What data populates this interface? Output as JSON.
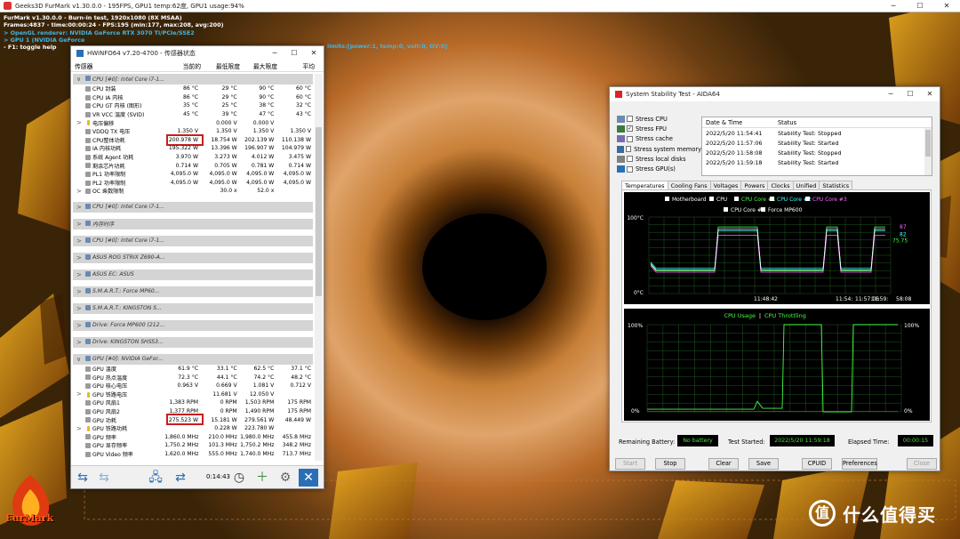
{
  "furmark": {
    "title": "Geeks3D FurMark v1.30.0.0 - 195FPS, GPU1 temp:62度, GPU1 usage:94%",
    "osd": [
      {
        "text": "FurMark v1.30.0.0 - Burn-in test, 1920x1080 (8X MSAA)",
        "color": "w"
      },
      {
        "text": "Frames:4837 - time:00:00:24 - FPS:195 (min:177, max:208, avg:200)",
        "color": "w"
      },
      {
        "text": "> OpenGL renderer: NVIDIA GeForce RTX 3070 Ti/PCIe/SSE2",
        "color": "c"
      },
      {
        "text": "> GPU 1 (NVIDIA GeForce",
        "color": "c"
      },
      {
        "text": "- F1: toggle help",
        "color": "w"
      }
    ],
    "limits_text": "limits:[power:1, temp:0, volt:0, OV:0]",
    "logo": "FurMark",
    "watermark": "值 什么值得买"
  },
  "hwinfo": {
    "title": "HWiNFO64 v7.20-4700 - 传感器状态",
    "columns": [
      "传感器",
      "当前的",
      "最低限度",
      "最大限度",
      "平均"
    ],
    "rows": [
      {
        "kind": "hdr",
        "name": "CPU [#0]: Intel Core i7-1...",
        "tog": "∨"
      },
      {
        "kind": "row",
        "dot": "g",
        "name": "CPU 封装",
        "v": [
          "86 °C",
          "29 °C",
          "90 °C",
          "60 °C"
        ]
      },
      {
        "kind": "row",
        "dot": "g",
        "name": "CPU IA 内核",
        "v": [
          "86 °C",
          "29 °C",
          "90 °C",
          "60 °C"
        ]
      },
      {
        "kind": "row",
        "dot": "g",
        "name": "CPU GT 内核 (图形)",
        "v": [
          "35 °C",
          "25 °C",
          "38 °C",
          "32 °C"
        ]
      },
      {
        "kind": "row",
        "dot": "g",
        "name": "VR VCC 温度 (SVID)",
        "v": [
          "45 °C",
          "39 °C",
          "47 °C",
          "43 °C"
        ]
      },
      {
        "kind": "row",
        "dot": "y",
        "tog": ">",
        "name": "电压偏移",
        "v": [
          "",
          "0.000 V",
          "0.000 V",
          ""
        ]
      },
      {
        "kind": "row",
        "dot": "g",
        "name": "VDDQ TX 电压",
        "v": [
          "1.350 V",
          "1.350 V",
          "1.350 V",
          "1.350 V"
        ]
      },
      {
        "kind": "row",
        "dot": "g",
        "name": "CPU整体功耗",
        "v": [
          "200.978 W",
          "18.754 W",
          "202.139 W",
          "110.138 W"
        ]
      },
      {
        "kind": "row",
        "dot": "g",
        "name": "IA 内核功耗",
        "v": [
          "195.322 W",
          "13.396 W",
          "196.907 W",
          "104.979 W"
        ]
      },
      {
        "kind": "row",
        "dot": "g",
        "name": "系统 Agent 功耗",
        "v": [
          "3.970 W",
          "3.273 W",
          "4.012 W",
          "3.475 W"
        ]
      },
      {
        "kind": "row",
        "dot": "g",
        "name": "剩余芯片功耗",
        "v": [
          "0.714 W",
          "0.705 W",
          "0.781 W",
          "0.714 W"
        ]
      },
      {
        "kind": "row",
        "dot": "g",
        "name": "PL1 功率限制",
        "v": [
          "4,095.0 W",
          "4,095.0 W",
          "4,095.0 W",
          "4,095.0 W"
        ]
      },
      {
        "kind": "row",
        "dot": "g",
        "name": "PL2 功率限制",
        "v": [
          "4,095.0 W",
          "4,095.0 W",
          "4,095.0 W",
          "4,095.0 W"
        ]
      },
      {
        "kind": "row",
        "dot": "g",
        "tog": ">",
        "name": "OC 乘数限制",
        "v": [
          "",
          "30.0 x",
          "52.0 x",
          ""
        ]
      },
      {
        "kind": "sp"
      },
      {
        "kind": "hdr",
        "name": "CPU [#0]: Intel Core i7-1...",
        "tog": ">"
      },
      {
        "kind": "sp"
      },
      {
        "kind": "hdr",
        "name": "内存时序",
        "tog": ">"
      },
      {
        "kind": "sp"
      },
      {
        "kind": "hdr",
        "name": "CPU [#0]: Intel Core i7-1...",
        "tog": ">"
      },
      {
        "kind": "sp"
      },
      {
        "kind": "hdr",
        "name": "ASUS ROG STRIX Z690-A...",
        "tog": ">"
      },
      {
        "kind": "sp"
      },
      {
        "kind": "hdr",
        "name": "ASUS EC: ASUS",
        "tog": ">"
      },
      {
        "kind": "sp"
      },
      {
        "kind": "hdr",
        "name": "S.M.A.R.T.: Force MP60...",
        "tog": ">"
      },
      {
        "kind": "sp"
      },
      {
        "kind": "hdr",
        "name": "S.M.A.R.T.: KINGSTON S...",
        "tog": ">"
      },
      {
        "kind": "sp"
      },
      {
        "kind": "hdr",
        "name": "Drive: Force MP600 (212...",
        "tog": ">"
      },
      {
        "kind": "sp"
      },
      {
        "kind": "hdr",
        "name": "Drive: KINGSTON SHSS3...",
        "tog": ">"
      },
      {
        "kind": "sp"
      },
      {
        "kind": "hdr",
        "name": "GPU [#0]: NVIDIA GeFor...",
        "tog": "∨"
      },
      {
        "kind": "row",
        "dot": "g",
        "name": "GPU 温度",
        "v": [
          "61.9 °C",
          "33.1 °C",
          "62.5 °C",
          "37.1 °C"
        ]
      },
      {
        "kind": "row",
        "dot": "g",
        "name": "GPU 热点温度",
        "v": [
          "72.3 °C",
          "44.1 °C",
          "74.2 °C",
          "48.2 °C"
        ]
      },
      {
        "kind": "row",
        "dot": "g",
        "name": "GPU 核心电压",
        "v": [
          "0.963 V",
          "0.669 V",
          "1.081 V",
          "0.712 V"
        ]
      },
      {
        "kind": "row",
        "dot": "y",
        "tog": ">",
        "name": "GPU 铁路电压",
        "v": [
          "",
          "11.681 V",
          "12.050 V",
          ""
        ]
      },
      {
        "kind": "row",
        "dot": "g",
        "name": "GPU 风扇1",
        "v": [
          "1,383 RPM",
          "0 RPM",
          "1,503 RPM",
          "175 RPM"
        ]
      },
      {
        "kind": "row",
        "dot": "g",
        "name": "GPU 风扇2",
        "v": [
          "1,377 RPM",
          "0 RPM",
          "1,490 RPM",
          "175 RPM"
        ]
      },
      {
        "kind": "row",
        "dot": "g",
        "name": "GPU 功耗",
        "v": [
          "275.523 W",
          "15.181 W",
          "279.561 W",
          "48.449 W"
        ]
      },
      {
        "kind": "row",
        "dot": "y",
        "tog": ">",
        "name": "GPU 铁路功耗",
        "v": [
          "",
          "0.228 W",
          "223.780 W",
          ""
        ]
      },
      {
        "kind": "row",
        "dot": "g",
        "name": "GPU 频率",
        "v": [
          "1,860.0 MHz",
          "210.0 MHz",
          "1,980.0 MHz",
          "455.8 MHz"
        ]
      },
      {
        "kind": "row",
        "dot": "g",
        "name": "GPU 显存频率",
        "v": [
          "1,750.2 MHz",
          "101.3 MHz",
          "1,750.2 MHz",
          "348.2 MHz"
        ]
      },
      {
        "kind": "row",
        "dot": "g",
        "name": "GPU Video 频率",
        "v": [
          "1,620.0 MHz",
          "555.0 MHz",
          "1,740.0 MHz",
          "713.7 MHz"
        ]
      }
    ],
    "timer": "0:14:43"
  },
  "aida": {
    "title": "System Stability Test - AIDA64",
    "stress": [
      {
        "label": "Stress CPU",
        "checked": false
      },
      {
        "label": "Stress FPU",
        "checked": true
      },
      {
        "label": "Stress cache",
        "checked": false
      },
      {
        "label": "Stress system memory",
        "checked": false
      },
      {
        "label": "Stress local disks",
        "checked": false
      },
      {
        "label": "Stress GPU(s)",
        "checked": false
      }
    ],
    "log_headers": [
      "Date & Time",
      "Status"
    ],
    "log": [
      [
        "2022/5/20 11:54:41",
        "Stability Test: Stopped"
      ],
      [
        "2022/5/20 11:57:06",
        "Stability Test: Started"
      ],
      [
        "2022/5/20 11:58:08",
        "Stability Test: Stopped"
      ],
      [
        "2022/5/20 11:59:18",
        "Stability Test: Started"
      ]
    ],
    "tabs": [
      "Temperatures",
      "Cooling Fans",
      "Voltages",
      "Powers",
      "Clocks",
      "Unified",
      "Statistics"
    ],
    "legend1": [
      "Motherboard",
      "CPU",
      "CPU Core #1",
      "CPU Core #2",
      "CPU Core #3"
    ],
    "legend2": [
      "CPU Core #4",
      "Force MP600"
    ],
    "legend_colors": [
      "#ffffff",
      "#ffffff",
      "#44ff44",
      "#44ffff",
      "#ff66ff",
      "#ffffff",
      "#ffffff"
    ],
    "temp_graph": {
      "ymax": "100°C",
      "ymin": "0°C",
      "t1": "11:48:42",
      "t2": "11:54:",
      "t3": "11:57:06",
      "t4": "11:59:",
      "t5": "58:08",
      "r1": "87",
      "r2": "82",
      "r3": "75.75"
    },
    "cpu_graph": {
      "title1": "CPU Usage",
      "sep": "|",
      "title2": "CPU Throttling",
      "l100": "100%",
      "l0": "0%",
      "r100": "100%",
      "r0": "0%"
    },
    "battery_label": "Remaining Battery:",
    "battery": "No battery",
    "started_label": "Test Started:",
    "started": "2022/5/20 11:59:18",
    "elapsed_label": "Elapsed Time:",
    "elapsed": "00:00:15",
    "buttons": [
      "Start",
      "Stop",
      "Clear",
      "Save",
      "CPUID",
      "Preferences",
      "Close"
    ]
  },
  "chart_data": [
    {
      "type": "line",
      "title": "",
      "ylim": [
        0,
        100
      ],
      "x": [
        "11:48:42",
        "11:54:",
        "11:57:06",
        "11:59:",
        "58:08"
      ],
      "series": [
        {
          "name": "CPU Core #1",
          "values": [
            30,
            87,
            30,
            87,
            30,
            87
          ]
        },
        {
          "name": "CPU Core #2",
          "values": [
            32,
            82,
            33,
            82,
            32,
            82
          ]
        },
        {
          "name": "CPU Core #3",
          "values": [
            30,
            76,
            31,
            76,
            30,
            76
          ]
        }
      ]
    },
    {
      "type": "line",
      "title": "CPU Usage",
      "ylim": [
        0,
        100
      ],
      "series": [
        {
          "name": "CPU Usage",
          "values": [
            0,
            0,
            0,
            100,
            100,
            0,
            100
          ]
        },
        {
          "name": "CPU Throttling",
          "values": [
            0,
            0,
            0,
            0,
            0,
            0,
            0
          ]
        }
      ]
    }
  ]
}
